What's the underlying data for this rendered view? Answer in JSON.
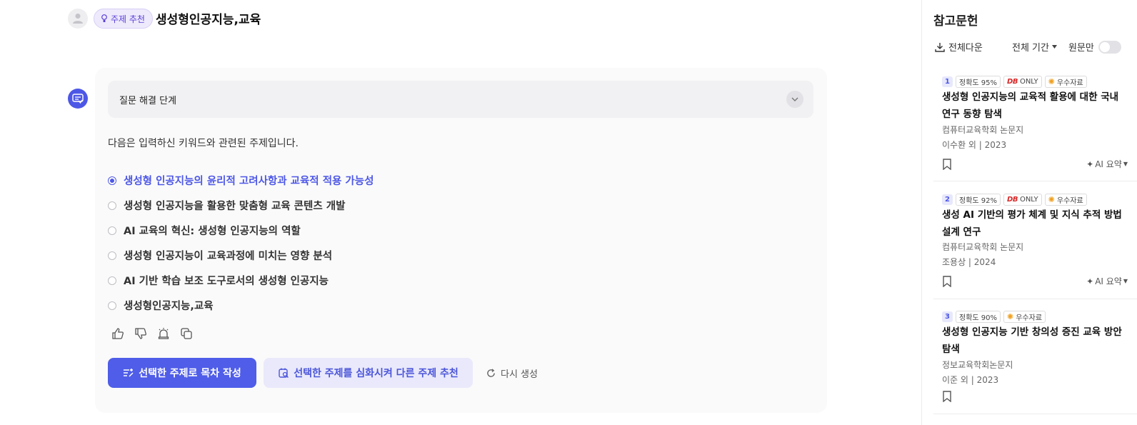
{
  "header": {
    "badge_label": "주제 추천",
    "title": "생성형인공지능,교육"
  },
  "answer": {
    "steps_label": "질문 해결 단계",
    "intro": "다음은 입력하신 키워드와 관련된 주제입니다.",
    "topics": [
      "생성형 인공지능의 윤리적 고려사항과 교육적 적용 가능성",
      "생성형 인공지능을 활용한 맞춤형 교육 콘텐츠 개발",
      "AI 교육의 혁신: 생성형 인공지능의 역할",
      "생성형 인공지능이 교육과정에 미치는 영향 분석",
      "AI 기반 학습 보조 도구로서의 생성형 인공지능",
      "생성형인공지능,교육"
    ],
    "selected_index": 0,
    "primary_button": "선택한 주제로 목차 작성",
    "secondary_button": "선택한 주제를 심화시켜 다른 주제 추천",
    "regenerate": "다시 생성"
  },
  "sidebar": {
    "title": "참고문헌",
    "download_all": "전체다운",
    "period": "전체 기간",
    "original_only": "원문만",
    "references": [
      {
        "rank": "1",
        "accuracy": "정확도 95%",
        "db_only": "ONLY",
        "db_logo": "DB",
        "excellent": "우수자료",
        "title": "생성형 인공지능의 교육적 활용에 대한 국내 연구 동향 탐색",
        "journal": "컴퓨터교육학회 논문지",
        "author": "이수환 외 | 2023",
        "ai_summary": "AI 요약"
      },
      {
        "rank": "2",
        "accuracy": "정확도 92%",
        "db_only": "ONLY",
        "db_logo": "DB",
        "excellent": "우수자료",
        "title": "생성 AI 기반의 평가 체계 및 지식 추적 방법 설계 연구",
        "journal": "컴퓨터교육학회 논문지",
        "author": "조용상 | 2024",
        "ai_summary": "AI 요약"
      },
      {
        "rank": "3",
        "accuracy": "정확도 90%",
        "excellent": "우수자료",
        "title": "생성형 인공지능 기반 창의성 증진 교육 방안 탐색",
        "journal": "정보교육학회논문지",
        "author": "이준 외 | 2023"
      }
    ]
  },
  "colors": {
    "accent": "#4f5de8",
    "accent_light": "#e9e9fb",
    "badge_bg": "#eeeafc"
  }
}
